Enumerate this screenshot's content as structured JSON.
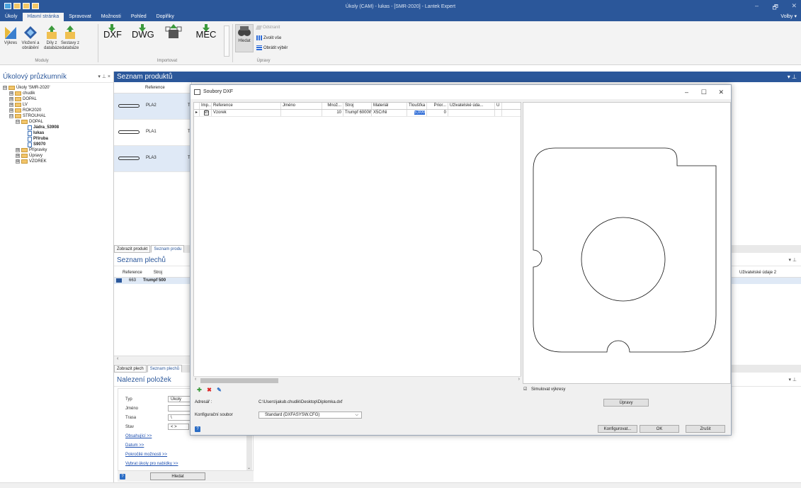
{
  "app": {
    "title": "Úkoly (CAM) - lukas - [SMR-2020] - Lantek Expert",
    "menu_tabs": [
      "Úkoly",
      "Hlavní stránka",
      "Spravovat",
      "Možnosti",
      "Pohled",
      "Doplňky"
    ],
    "active_tab": "Hlavní stránka",
    "right_menu": "Volby ▾",
    "win_buttons": [
      "–",
      "🗗",
      "✕"
    ]
  },
  "ribbon": {
    "moduly": {
      "group": "Moduly",
      "vykres": "Výkres",
      "vlozeni": "Vložení a obrábění",
      "dily": "Díly z databáze",
      "sestavy": "Sestavy z databáze"
    },
    "importovat": {
      "group": "Importovat",
      "dxf": "DXF",
      "dwg": "DWG",
      "mec": "MEC"
    },
    "upravy": {
      "group": "Úpravy",
      "hledat": "Hledat",
      "odstranit": "Odstranit",
      "zvolit": "Zvolit vše",
      "obratit": "Obrátit výběr"
    }
  },
  "left_panel": {
    "title": "Úkolový průzkumník",
    "tree": [
      {
        "label": "Úkoly 'SMR-2020'",
        "level": 0,
        "exp": "⊟",
        "type": "root"
      },
      {
        "label": "chudik",
        "level": 1,
        "exp": "⊞",
        "type": "folder"
      },
      {
        "label": "DOPAL",
        "level": 1,
        "exp": "⊞",
        "type": "folder"
      },
      {
        "label": "LV",
        "level": 1,
        "exp": "⊞",
        "type": "folder"
      },
      {
        "label": "ROK2020",
        "level": 1,
        "exp": "⊞",
        "type": "folder"
      },
      {
        "label": "STROUHAL",
        "level": 1,
        "exp": "⊟",
        "type": "folder"
      },
      {
        "label": "DOPAL",
        "level": 2,
        "exp": "⊟",
        "type": "folder"
      },
      {
        "label": "Jádra_53908",
        "level": 3,
        "exp": "",
        "type": "doc",
        "bold": true
      },
      {
        "label": "lukas",
        "level": 3,
        "exp": "",
        "type": "doc",
        "bold": true
      },
      {
        "label": "Příruba",
        "level": 3,
        "exp": "",
        "type": "doc",
        "bold": true
      },
      {
        "label": "S9070",
        "level": 3,
        "exp": "",
        "type": "doc",
        "bold": true
      },
      {
        "label": "Přípravky",
        "level": 2,
        "exp": "⊞",
        "type": "folder"
      },
      {
        "label": "Úpravy",
        "level": 2,
        "exp": "⊞",
        "type": "folder"
      },
      {
        "label": "VZOREK",
        "level": 2,
        "exp": "⊞",
        "type": "folder"
      }
    ]
  },
  "products": {
    "title": "Seznam produktů",
    "col_reference": "Reference",
    "rows": [
      {
        "ref": "PLA2",
        "extra": "T",
        "selected": true
      },
      {
        "ref": "PLA1",
        "extra": "T",
        "selected": false
      },
      {
        "ref": "PLA3",
        "extra": "T",
        "selected": true
      }
    ],
    "tabs": [
      "Zobrazit produkt",
      "Seznam produ"
    ]
  },
  "sheets": {
    "title": "Seznam plechů",
    "cols": [
      "Reference",
      "Stroj"
    ],
    "row": {
      "ref": "663",
      "stroj": "Trumpf 500"
    },
    "right_col": "Uživatelské údaje 2",
    "tabs": [
      "Zobrazit plech",
      "Seznam plechů"
    ],
    "scroll_left": "‹"
  },
  "find": {
    "title": "Nalezení položek",
    "fields": [
      {
        "label": "Typ",
        "value": "Úkoly"
      },
      {
        "label": "Jméno",
        "value": ""
      },
      {
        "label": "Trasa",
        "value": "\\"
      },
      {
        "label": "Stav",
        "value": "< >"
      }
    ],
    "links": [
      "Obsahující >>",
      "Datum >>",
      "Pokročilé možnosti >>",
      "Vybrat úkoly pro nabídky >>"
    ],
    "search_button": "Hledat",
    "help": "?",
    "scroll_down": "⌄"
  },
  "dialog": {
    "title": "Soubory DXF",
    "win_buttons": [
      "–",
      "☐",
      "✕"
    ],
    "columns": [
      "",
      "Imp...",
      "Reference",
      "Jméno",
      "Množ...",
      "Stroj",
      "Materiál",
      "Tloušťka",
      "Prior...",
      "Uživatelské úda...",
      "U"
    ],
    "row": {
      "marker": "▸",
      "import": "☑",
      "reference": "Vzorek",
      "jmeno": "",
      "mnozstvi": "10",
      "stroj": "Trumpf 6000W",
      "material": "X5CrNi",
      "tloustka": "5,000",
      "priorita": "0",
      "uziv": "",
      "u": ""
    },
    "scroll_left": "‹",
    "scroll_right": "›",
    "toolbar": {
      "add": "✚",
      "delete": "✖",
      "edit": "✎"
    },
    "simulate_label": "Simulovat výkresy",
    "simulate_checked": "☑",
    "adresar_label": "Adresář :",
    "adresar_value": "C:\\Users\\jakub.chudik\\Desktop\\Diplomka.dxf",
    "upravy_button": "Úpravy",
    "config_label": "Konfigurační soubor",
    "config_value": "Standard (DXFASYSW.CFG)",
    "config_arrow": "⌵",
    "help": "?",
    "buttons": {
      "konfig": "Konfigurovat...",
      "ok": "OK",
      "zrusit": "Zrušit"
    }
  },
  "colors": {
    "accent": "#2b579a",
    "selection": "#dfe9f6",
    "highlight": "#2d6bd6"
  }
}
